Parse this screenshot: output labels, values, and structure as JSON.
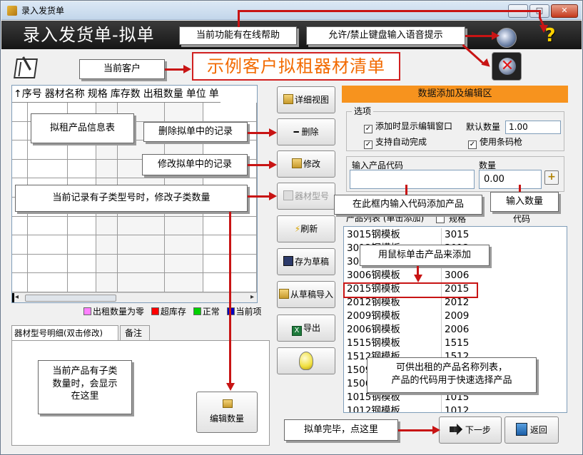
{
  "window": {
    "title": "录入发货单",
    "min": "–",
    "max": "□",
    "close": "✕"
  },
  "banner": {
    "title": "录入发货单-拟单"
  },
  "customer": {
    "text": "示例客户拟租器材清单"
  },
  "callouts": {
    "help": "当前功能有在线帮助",
    "voice": "允许/禁止键盘输入语音提示",
    "customer": "当前客户",
    "grid": "拟租产品信息表",
    "delete": "删除拟单中的记录",
    "modify": "修改拟单中的记录",
    "subtype": "当前记录有子类型号时，修改子类数量",
    "input_code": "在此框内输入代码添加产品",
    "input_qty": "输入数量",
    "click_add": "用鼠标单击产品来添加",
    "sub_display": [
      "当前产品有子类",
      "数量时，会显示",
      "在这里"
    ],
    "list_info": [
      "可供出租的产品名称列表，",
      "产品的代码用于快速选择产品"
    ],
    "finish": "拟单完毕，点这里"
  },
  "grid": {
    "columns": [
      "↑序号",
      "器材名称",
      "规格",
      "库存数",
      "出租数量",
      "单位",
      "单"
    ]
  },
  "legend": [
    {
      "label": "出租数量为零",
      "color": "#ff80ff"
    },
    {
      "label": "超库存",
      "color": "#ff0000"
    },
    {
      "label": "正常",
      "color": "#00d000"
    },
    {
      "label": "当前项",
      "color": "#0000c0"
    }
  ],
  "tabs": {
    "detail": "器材型号明细(双击修改)",
    "note": "备注"
  },
  "edit_qty_button": "编辑数量",
  "side_buttons": {
    "detail": "详细视图",
    "delete": "删除",
    "modify": "修改",
    "model": "器材型号",
    "refresh": "刷新",
    "save_draft": "存为草稿",
    "import_draft": "从草稿导入",
    "export": "导出"
  },
  "right_panel": {
    "header": "数据添加及编辑区",
    "options_legend": "选项",
    "show_edit_window": "添加时显示编辑窗口",
    "auto_complete": "支持自动完成",
    "default_qty_label": "默认数量",
    "default_qty": "1.00",
    "use_barcode": "使用条码枪",
    "code_label": "输入产品代码",
    "qty_label": "数量",
    "qty_value": "0.00",
    "add": "+",
    "list_head": "产品列表 (单击添加)",
    "spec_label": "规格",
    "code_col": "代码"
  },
  "products": [
    {
      "name": "3015钢模板",
      "code": "3015"
    },
    {
      "name": "3012钢模板",
      "code": "3012"
    },
    {
      "name": "3009钢模板",
      "code": "3009"
    },
    {
      "name": "3006钢模板",
      "code": "3006"
    },
    {
      "name": "2015钢模板",
      "code": "2015"
    },
    {
      "name": "2012钢模板",
      "code": "2012"
    },
    {
      "name": "2009钢模板",
      "code": "2009"
    },
    {
      "name": "2006钢模板",
      "code": "2006"
    },
    {
      "name": "1515钢模板",
      "code": "1515"
    },
    {
      "name": "1512钢模板",
      "code": "1512"
    },
    {
      "name": "1509钢模板",
      "code": "1509"
    },
    {
      "name": "1506钢模板",
      "code": "1506"
    },
    {
      "name": "1015钢模板",
      "code": "1015"
    },
    {
      "name": "1012钢模板",
      "code": "1012"
    }
  ],
  "bottom_buttons": {
    "next": "下一步",
    "back": "返回"
  },
  "colors": {
    "accent": "#f7931e",
    "banner": "#1a1a1a",
    "arrow": "#c81414",
    "customer_text": "#f26a00"
  }
}
